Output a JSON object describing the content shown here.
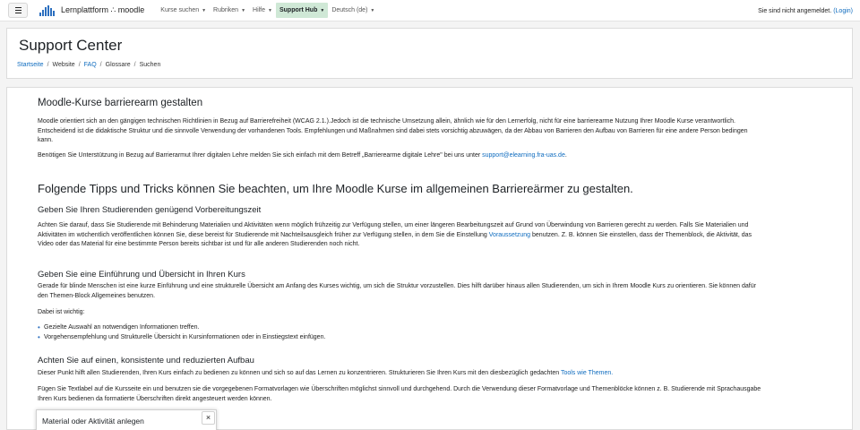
{
  "navbar": {
    "brand": "Lernplattform ∴ moodle",
    "menu": [
      {
        "label": "Kurse suchen",
        "caret": "▼"
      },
      {
        "label": "Rubriken",
        "caret": "▼"
      },
      {
        "label": "Hilfe",
        "caret": "▼"
      },
      {
        "label": "Support Hub",
        "caret": "▼",
        "active": true
      },
      {
        "label": "Deutsch (de)",
        "caret": "▼"
      }
    ],
    "login_text": "Sie sind nicht angemeldet.",
    "login_link": "(Login)"
  },
  "header": {
    "title": "Support Center",
    "breadcrumb": [
      {
        "label": "Startseite",
        "link": true
      },
      {
        "label": "Website",
        "link": false
      },
      {
        "label": "FAQ",
        "link": true
      },
      {
        "label": "Glossare",
        "link": false
      },
      {
        "label": "Suchen",
        "link": false
      }
    ],
    "separator": "/"
  },
  "content": {
    "heading1": "Moodle-Kurse barrierearm gestalten",
    "para1": "Moodle orientiert sich an den gängigen technischen Richtlinien in Bezug auf Barrierefreiheit (WCAG 2.1.).Jedoch ist die technische Umsetzung allein, ähnlich wie für den Lernerfolg, nicht für eine barrierearme Nutzung Ihrer Moodle Kurse verantwortlich. Entscheidend ist die didaktische Struktur und die sinnvolle Verwendung der vorhandenen Tools. Empfehlungen und Maßnahmen sind dabei stets vorsichtig abzuwägen, da der Abbau von Barrieren den Aufbau von Barrieren für eine andere Person bedingen kann.",
    "para2_text": "Benötigen Sie Unterstützung in Bezug auf Barrierarmut Ihrer digitalen Lehre melden Sie sich einfach mit dem Betreff „Barrierearme digitale Lehre\" bei uns unter ",
    "para2_link": "support@elearning.fra-uas.de",
    "para2_end": ".",
    "heading2": "Folgende Tipps und Tricks können Sie beachten, um Ihre Moodle Kurse im allgemeinen Barriereärmer zu gestalten.",
    "sub1": "Geben Sie Ihren Studierenden genügend Vorbereitungszeit",
    "sub1_text": " Achten Sie darauf, dass Sie Studierende mit Behinderung Materialien und Aktivitäten wenn möglich frühzeitig zur Verfügung stellen, um einer längeren Bearbeitungszeit auf Grund von Überwindung von Barrieren gerecht zu werden. Falls Sie Materialien und Aktivitäten im wöchentlich veröffentlichen können Sie, diese bereist für Studierende mit Nachteilsausgleich früher zur Verfügung stellen, in dem Sie die Einstellung ",
    "sub1_link": "Voraussetzung",
    "sub1_text_end": " benutzen. Z. B. können Sie einstellen, dass der Themenblock, die Aktivität, das Video oder das Material für eine bestimmte Person bereits sichtbar ist und für alle anderen Studierenden noch nicht.",
    "sub2": "Geben Sie eine Einführung und Übersicht in Ihren Kurs",
    "sub2_text": "Gerade für blinde Menschen ist eine kurze Einführung und eine strukturelle Übersicht am Anfang des Kurses wichtig, um sich die Struktur vorzustellen. Dies hilft darüber hinaus allen Studierenden, um sich in Ihrem Moodle Kurs zu orientieren. Sie können dafür den Themen-Block Allgemeines benutzen.",
    "sub2_note": "Dabei ist wichtig:",
    "sub2_list": [
      "Gezielte Auswahl an notwendigen Informationen treffen.",
      "Vorgehensempfehlung und Strukturelle Übersicht in Kursinformationen oder in Einstiegstext einfügen."
    ],
    "sub3": "Achten Sie auf einen, konsistente und reduzierten Aufbau",
    "sub3_text": "Dieser Punkt hilft allen Studierenden, Ihren Kurs einfach zu bedienen zu können und sich so auf das Lernen zu konzentrieren. Strukturieren Sie Ihren Kurs mit den diesbezüglich gedachten ",
    "sub3_link": "Tools wie Themen.",
    "sub3_text2": "Fügen Sie Textlabel auf die Kursseite ein und benutzen sie die vorgegebenen Formatvorlagen wie Überschriften möglichst sinnvoll und durchgehend. Durch die Verwendung dieser Formatvorlage und Themenblöcke können z. B. Studierende mit Sprachausgabe Ihren Kurs bedienen da formatierte Überschriften direkt angesteuert werden können."
  },
  "popup": {
    "title": "Material oder Aktivität anlegen",
    "close": "×"
  },
  "colors": {
    "link": "#0f6cbf",
    "active_menu_bg": "#cfe8d6",
    "brand_blue": "#2c6fbf"
  }
}
